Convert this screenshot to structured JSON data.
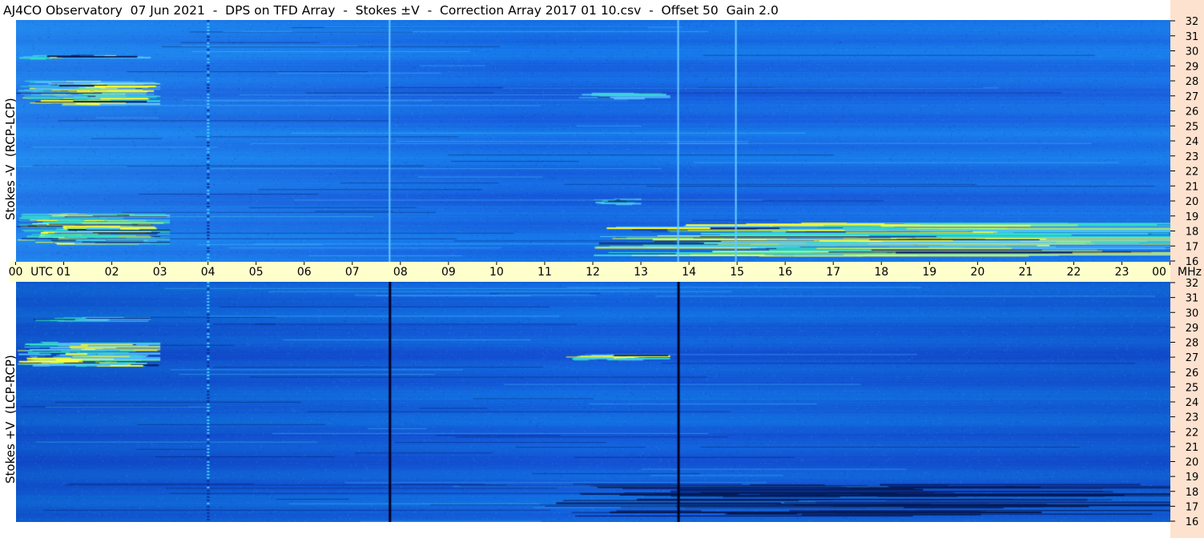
{
  "title": "AJ4CO Observatory  07 Jun 2021  -  DPS on TFD Array  -  Stokes ±V  -  Correction Array 2017 01 10.csv  -  Offset 50  Gain 2.0",
  "colors": {
    "background_blue": "#1a66ee",
    "time_axis_bg": "#ffffcc",
    "freq_strip_bg": "#fde2cf",
    "hot": "#ffff33",
    "mid": "#33ddcc",
    "dark": "#051a55"
  },
  "chart_data": [
    {
      "type": "heatmap",
      "name": "upper",
      "ylabel": "Stokes -V  (RCP-LCP)",
      "y_unit": "MHz",
      "y_range": [
        16,
        32
      ],
      "y_ticks": [
        "32",
        "31",
        "30",
        "29",
        "28",
        "27",
        "26",
        "25",
        "24",
        "23",
        "22",
        "21",
        "20",
        "19",
        "18",
        "17",
        "16"
      ],
      "x_range_utc_hours": [
        0,
        24
      ],
      "vertical_lines_utc": [
        7.75,
        13.75,
        14.95
      ],
      "vertical_line_color": "#66ccff",
      "emission_bands": [
        {
          "utc": [
            0,
            3.0
          ],
          "mhz": [
            26.4,
            28.0
          ],
          "intensity": "high"
        },
        {
          "utc": [
            0,
            2.8
          ],
          "mhz": [
            29.4,
            29.7
          ],
          "intensity": "high"
        },
        {
          "utc": [
            0,
            3.2
          ],
          "mhz": [
            17.2,
            19.2
          ],
          "intensity": "high"
        },
        {
          "utc": [
            11.4,
            13.6
          ],
          "mhz": [
            26.8,
            27.2
          ],
          "intensity": "medium"
        },
        {
          "utc": [
            12.0,
            24.0
          ],
          "mhz": [
            16.4,
            18.6
          ],
          "intensity": "high"
        },
        {
          "utc": [
            12.0,
            13.0
          ],
          "mhz": [
            19.8,
            20.2
          ],
          "intensity": "medium"
        }
      ],
      "dotted_line_utc": 3.97
    },
    {
      "type": "heatmap",
      "name": "lower",
      "ylabel": "Stokes +V  (LCP-RCP)",
      "y_unit": "MHz",
      "y_range": [
        16,
        32
      ],
      "y_ticks": [
        "32",
        "31",
        "30",
        "29",
        "28",
        "27",
        "26",
        "25",
        "24",
        "23",
        "22",
        "21",
        "20",
        "19",
        "18",
        "17",
        "16"
      ],
      "x_range_utc_hours": [
        0,
        24
      ],
      "vertical_lines_utc": [
        7.75,
        13.75
      ],
      "vertical_line_color": "#000020",
      "emission_bands": [
        {
          "utc": [
            0,
            3.0
          ],
          "mhz": [
            26.4,
            28.0
          ],
          "intensity": "high"
        },
        {
          "utc": [
            0,
            2.8
          ],
          "mhz": [
            29.4,
            29.7
          ],
          "intensity": "medium"
        },
        {
          "utc": [
            11.4,
            13.6
          ],
          "mhz": [
            26.8,
            27.2
          ],
          "intensity": "high"
        },
        {
          "utc": [
            11.0,
            24.0
          ],
          "mhz": [
            16.4,
            18.6
          ],
          "intensity": "dark"
        }
      ],
      "dotted_line_utc": 3.97
    }
  ],
  "time_axis": {
    "ticks": [
      "00",
      "01",
      "02",
      "03",
      "04",
      "05",
      "06",
      "07",
      "08",
      "09",
      "10",
      "11",
      "12",
      "13",
      "14",
      "15",
      "16",
      "17",
      "18",
      "19",
      "20",
      "21",
      "22",
      "23",
      "00"
    ],
    "utc_label": "UTC",
    "unit_label": "MHz"
  }
}
